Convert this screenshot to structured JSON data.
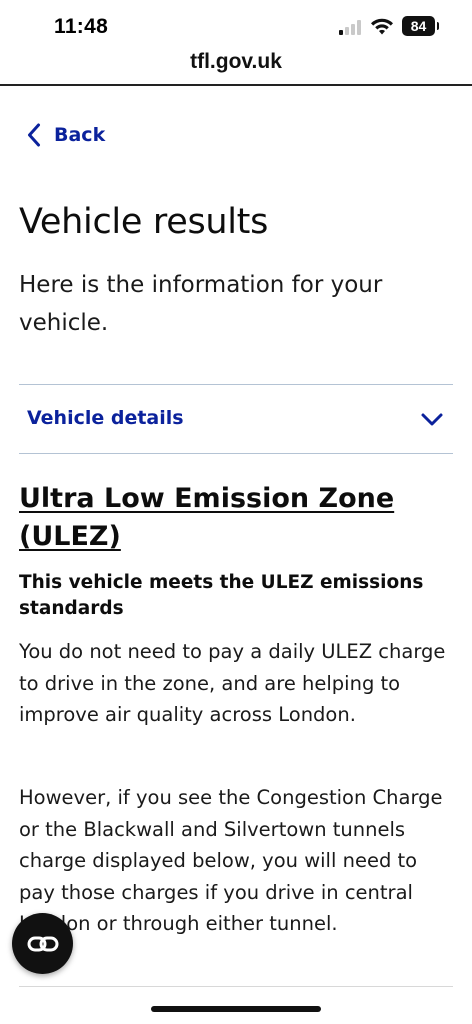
{
  "status_bar": {
    "time": "11:48",
    "battery": "84",
    "signal_bars_active": 1,
    "signal_bars_total": 4
  },
  "url_bar": {
    "url": "tfl.gov.uk"
  },
  "page": {
    "back_label": "Back",
    "title": "Vehicle results",
    "intro": "Here is the information for your vehicle.",
    "vehicle_details_label": "Vehicle details",
    "ulez_heading": "Ultra Low Emission Zone (ULEZ)",
    "meets_standards": "This vehicle meets the ULEZ emissions standards",
    "paragraph_1": "You do not need to pay a daily ULEZ charge to drive in the zone, and are helping to improve air quality across London.",
    "paragraph_2": "However, if you see the Congestion Charge or the Blackwall and Silvertown tunnels charge displayed below, you will need to pay those charges if you drive in central London or through either tunnel."
  },
  "colors": {
    "link_blue": "#0b229c",
    "divider": "#b4c3d4",
    "text": "#0d0d0d"
  },
  "icons": {
    "back": "chevron-left-icon",
    "details_toggle": "chevron-down-icon",
    "floating_button": "link-icon",
    "wifi": "wifi-icon",
    "signal": "cellular-signal-icon"
  }
}
